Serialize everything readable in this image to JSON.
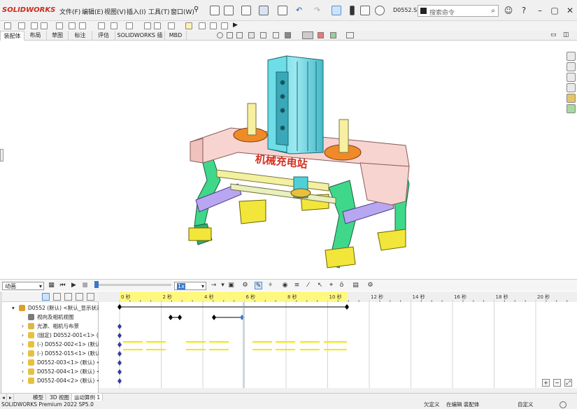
{
  "app": {
    "logo_text": "SOLIDWORKS",
    "file_tab": "D0552.S...",
    "search_placeholder": "搜索命令"
  },
  "menu": [
    "文件(F)",
    "编辑(E)",
    "视图(V)",
    "插入(I)",
    "工具(T)",
    "窗口(W)"
  ],
  "command_tabs": [
    {
      "label": "装配体",
      "active": true
    },
    {
      "label": "布局",
      "active": false
    },
    {
      "label": "草图",
      "active": false
    },
    {
      "label": "标注",
      "active": false
    },
    {
      "label": "评估",
      "active": false
    },
    {
      "label": "SOLIDWORKS 插件",
      "active": false
    },
    {
      "label": "MBD",
      "active": false
    }
  ],
  "viewport": {
    "model_caption": "机械充电站"
  },
  "motion": {
    "study_type": "动画",
    "speed": "1x"
  },
  "timeline": {
    "ticks": [
      "0 秒",
      "2 秒",
      "4 秒",
      "6 秒",
      "8 秒",
      "10 秒",
      "12 秒",
      "14 秒",
      "16 秒",
      "18 秒",
      "20 秒"
    ]
  },
  "tree": {
    "rows": [
      {
        "label": "D0552 (默认) <默认_显示状态",
        "icon_color": "#d9a02a"
      },
      {
        "label": "视向及相机视图",
        "icon_color": "#7a7a7a"
      },
      {
        "label": "光源、相机与布景",
        "icon_color": "#d9b84a"
      },
      {
        "label": "(固定) D0552-001<1> (默",
        "icon_color": "#e8c040"
      },
      {
        "label": "(-) D0552-002<1> (默认)",
        "icon_color": "#e8c040"
      },
      {
        "label": "(-) D0552-015<1> (默认)",
        "icon_color": "#e8c040"
      },
      {
        "label": "D0552-003<1> (默认) <",
        "icon_color": "#e8c040"
      },
      {
        "label": "D0552-004<1> (默认) <",
        "icon_color": "#e8c040"
      },
      {
        "label": "D0552-004<2> (默认) <",
        "icon_color": "#e8c040"
      }
    ]
  },
  "bottom_tabs": [
    {
      "label": "模型",
      "active": false
    },
    {
      "label": "3D 视图",
      "active": false
    },
    {
      "label": "运动算例 1",
      "active": true
    }
  ],
  "status": {
    "product": "SOLIDWORKS Premium 2022 SP5.0",
    "constraint": "欠定义",
    "mode": "在编辑 装配体",
    "units": "自定义"
  },
  "colors": {
    "accent": "#3a78c8",
    "timeline_header": "#fff880",
    "key_bars": "#f4e800"
  }
}
